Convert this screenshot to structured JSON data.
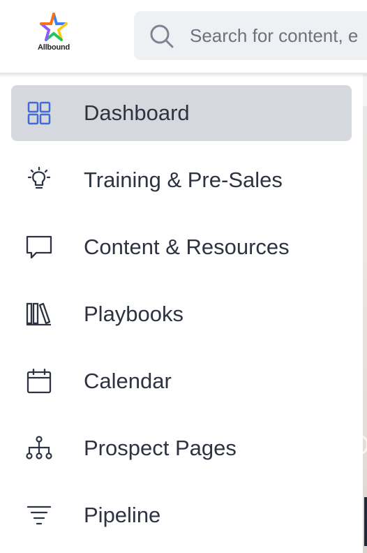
{
  "header": {
    "logo_text": "Allbound",
    "search": {
      "placeholder": "Search for content, e"
    }
  },
  "sidebar": {
    "items": [
      {
        "label": "Dashboard",
        "icon": "grid-icon",
        "active": true
      },
      {
        "label": "Training & Pre-Sales",
        "icon": "lightbulb-icon",
        "active": false
      },
      {
        "label": "Content & Resources",
        "icon": "chat-bubble-icon",
        "active": false
      },
      {
        "label": "Playbooks",
        "icon": "books-icon",
        "active": false
      },
      {
        "label": "Calendar",
        "icon": "calendar-icon",
        "active": false
      },
      {
        "label": "Prospect Pages",
        "icon": "sitemap-icon",
        "active": false
      },
      {
        "label": "Pipeline",
        "icon": "filter-icon",
        "active": false
      }
    ]
  },
  "colors": {
    "active_bg": "#d5d8dd",
    "active_icon": "#4169d8",
    "text": "#2d3340",
    "search_bg": "#eef0f3"
  }
}
